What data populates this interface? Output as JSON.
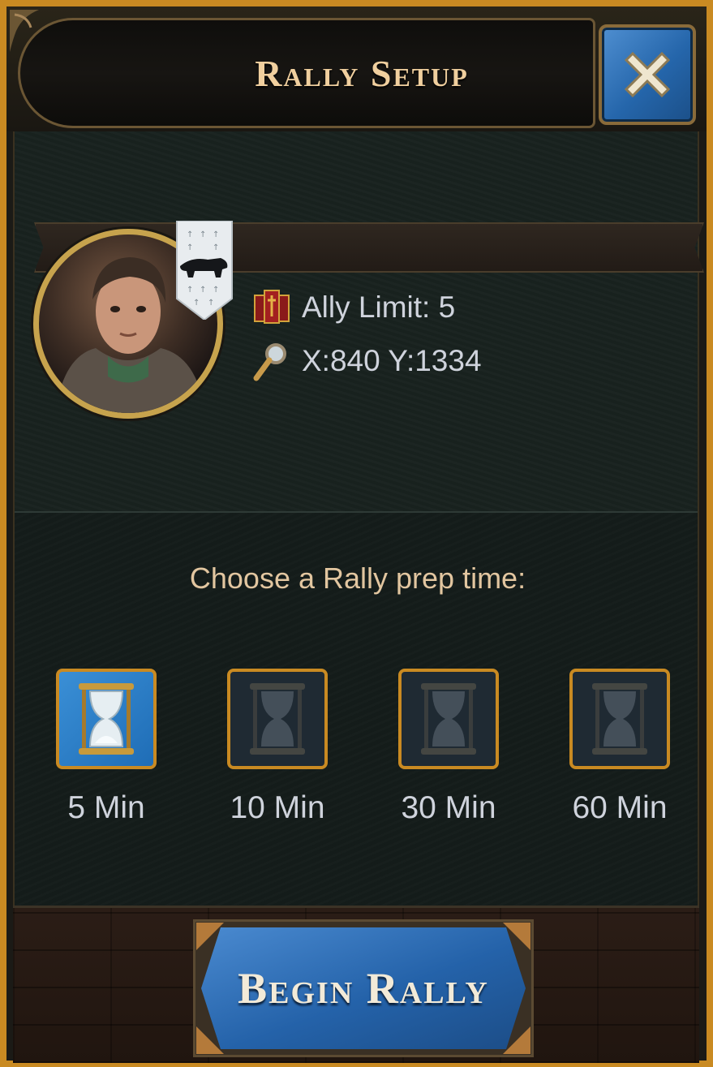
{
  "header": {
    "title": "Rally Setup"
  },
  "info": {
    "ally_limit": "Ally Limit: 5",
    "coordinates": "X:840 Y:1334"
  },
  "prep": {
    "prompt": "Choose a Rally prep time:",
    "options": [
      {
        "label": "5 Min",
        "selected": true
      },
      {
        "label": "10 Min",
        "selected": false
      },
      {
        "label": "30 Min",
        "selected": false
      },
      {
        "label": "60 Min",
        "selected": false
      }
    ]
  },
  "footer": {
    "begin_label": "Begin Rally"
  },
  "colors": {
    "gold_trim": "#c98a22",
    "title_text": "#f0cf9e",
    "prompt_text": "#e2c6a0",
    "button_blue": "#2566ab"
  }
}
